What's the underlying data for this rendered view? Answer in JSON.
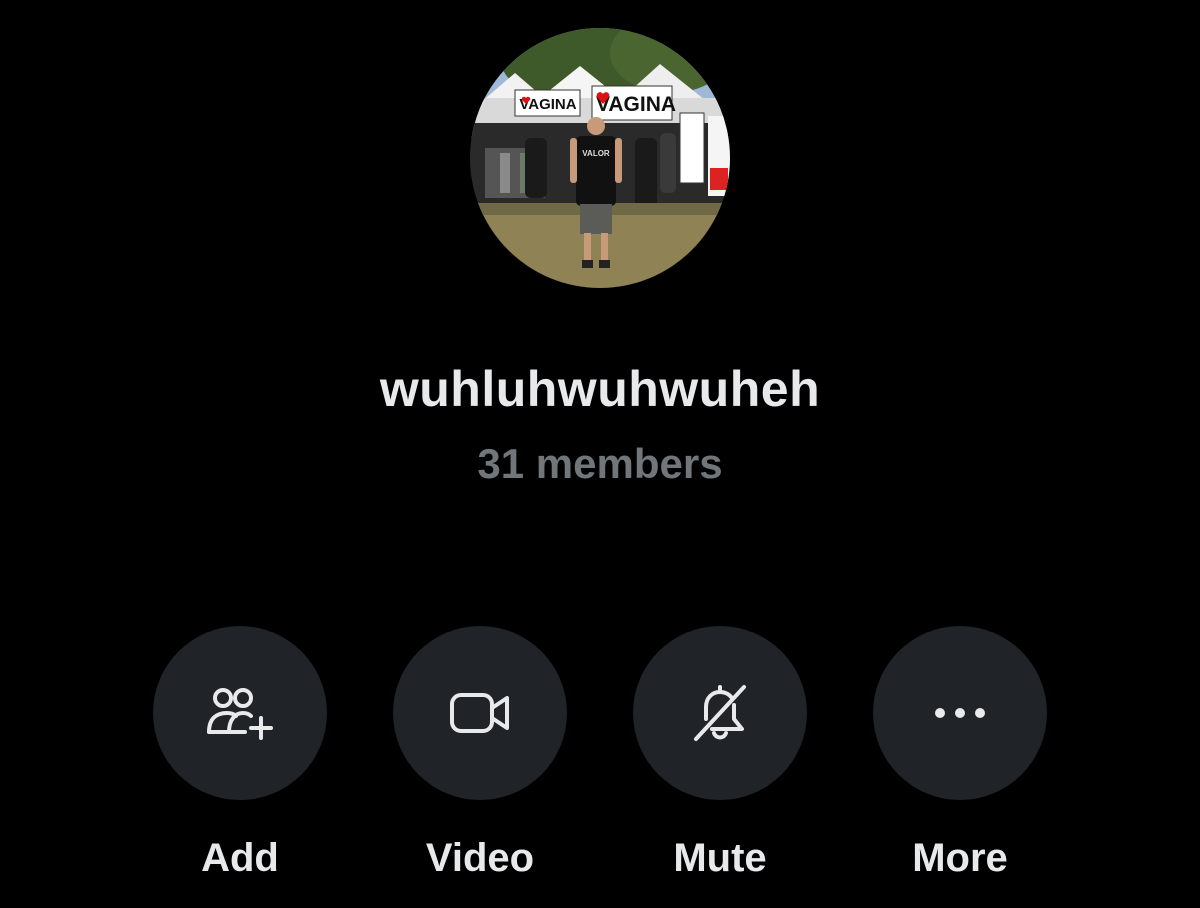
{
  "group": {
    "name": "wuhluhwuhwuheh",
    "members": "31 members",
    "avatar_banner_text": "VAGINA",
    "avatar_shirt_text": "VALOR"
  },
  "actions": [
    {
      "label": "Add",
      "icon": "add-people-icon"
    },
    {
      "label": "Video",
      "icon": "video-camera-icon"
    },
    {
      "label": "Mute",
      "icon": "bell-off-icon"
    },
    {
      "label": "More",
      "icon": "more-dots-icon"
    }
  ],
  "colors": {
    "background": "#000000",
    "primary_text": "#e7e9ea",
    "secondary_text": "#71767b",
    "button_background": "#202327"
  }
}
